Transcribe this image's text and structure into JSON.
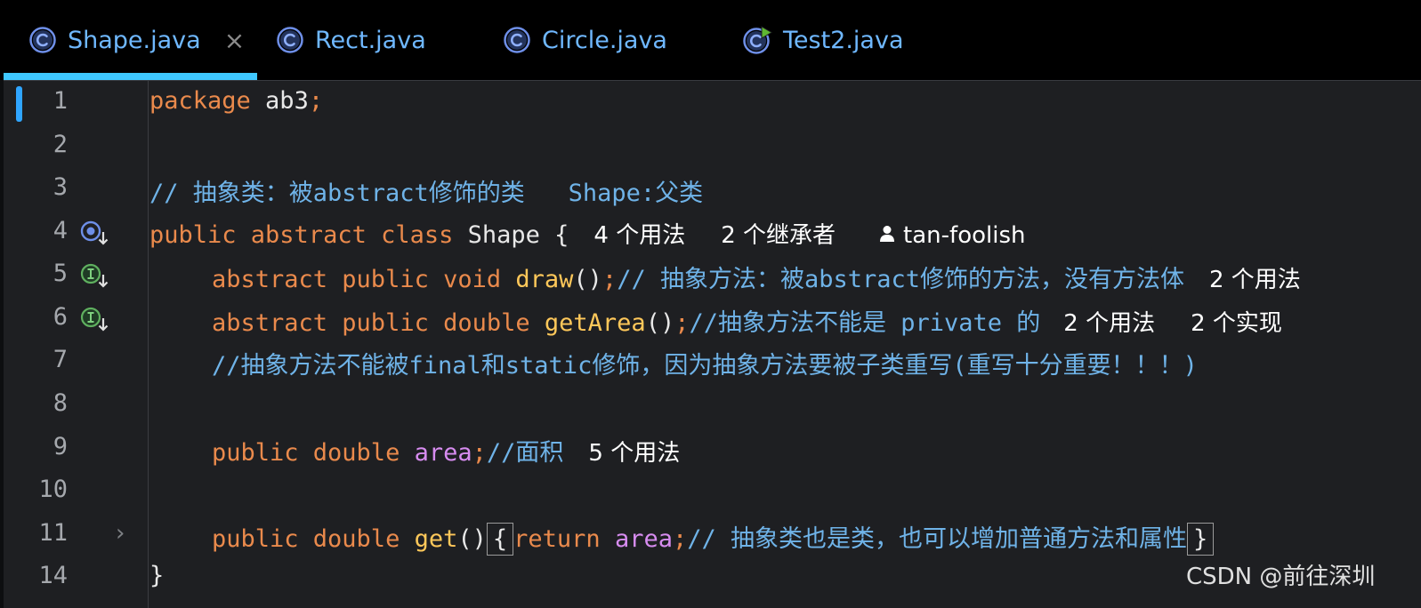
{
  "tabs": [
    {
      "label": "Shape.java",
      "active": true,
      "close": "×",
      "icon": "class-icon"
    },
    {
      "label": "Rect.java",
      "active": false,
      "icon": "class-icon"
    },
    {
      "label": "Circle.java",
      "active": false,
      "icon": "class-icon"
    },
    {
      "label": "Test2.java",
      "active": false,
      "icon": "runnable-class-icon"
    }
  ],
  "editor": {
    "line_numbers": [
      "1",
      "2",
      "3",
      "4",
      "5",
      "6",
      "7",
      "8",
      "9",
      "10",
      "11",
      "14"
    ],
    "line1": {
      "kw": "package",
      "text": " ab3",
      "semi": ";"
    },
    "line3": {
      "comment": "// 抽象类：被abstract修饰的类   Shape:父类"
    },
    "line4": {
      "kw": "public abstract class",
      "name": " Shape {",
      "hint_usages": "4 个用法",
      "hint_inheritors": "2 个继承者",
      "hint_author": "tan-foolish"
    },
    "line5": {
      "kw": "abstract public void",
      "fn": "draw",
      "paren": "()",
      "semi": ";",
      "comment": "// 抽象方法：被abstract修饰的方法，没有方法体",
      "hint_usages": "2 个用法"
    },
    "line6": {
      "kw": "abstract public double",
      "fn": "getArea",
      "paren": "()",
      "semi": ";",
      "comment": "//抽象方法不能是 private 的",
      "hint_usages": "2 个用法",
      "hint_impls": "2 个实现"
    },
    "line7": {
      "comment": "//抽象方法不能被final和static修饰，因为抽象方法要被子类重写(重写十分重要！！！)"
    },
    "line9": {
      "kw": "public double",
      "field": "area",
      "semi": ";",
      "comment": "//面积",
      "hint_usages": "5 个用法"
    },
    "line11": {
      "kw": "public double",
      "fn": "get",
      "paren": "()",
      "brace_open": "{",
      "ret": "return",
      "field": "area",
      "semi": ";",
      "comment": "// 抽象类也是类，也可以增加普通方法和属性",
      "brace_close": "}",
      "fold": "›"
    },
    "line14": {
      "brace": "}"
    }
  },
  "gutter_icons": [
    "overridden-class-icon",
    "implemented-method-icon",
    "implemented-method-icon"
  ],
  "watermark": "CSDN @前往深圳",
  "colors": {
    "keyword": "#ea8a4c",
    "comment": "#6fb3e8",
    "function": "#ffc85a",
    "field": "#d78cf0",
    "tab_text": "#6fb8ff",
    "tab_indicator": "#3fc8ff",
    "background": "#1e1f22"
  }
}
